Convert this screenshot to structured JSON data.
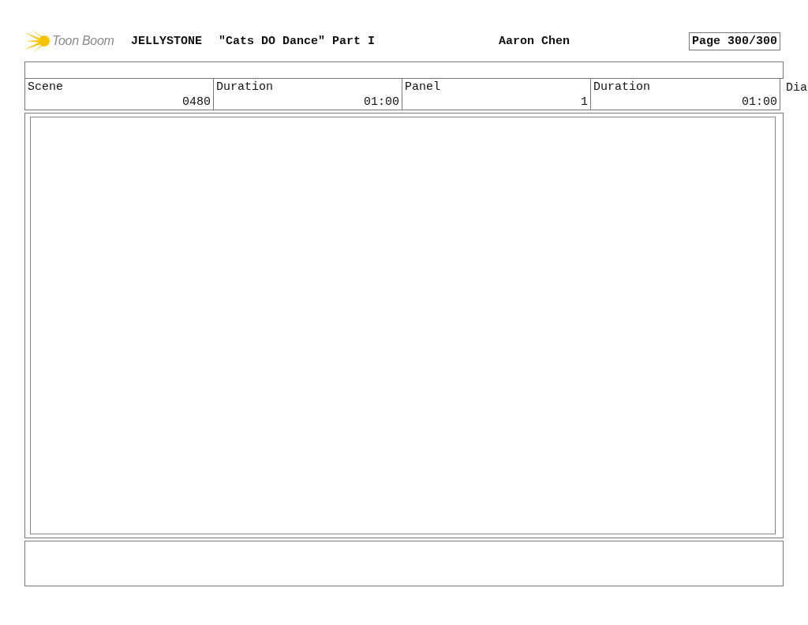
{
  "header": {
    "logo_text": "Toon Boom",
    "project": "JELLYSTONE",
    "episode": "\"Cats DO Dance\" Part I",
    "author": "Aaron Chen",
    "page": "Page 300/300"
  },
  "info_table": {
    "columns": [
      "Scene",
      "Duration",
      "Panel",
      "Duration",
      "Dia"
    ],
    "rows": [
      [
        "0480",
        "01:00",
        "1",
        "01:00"
      ]
    ]
  }
}
